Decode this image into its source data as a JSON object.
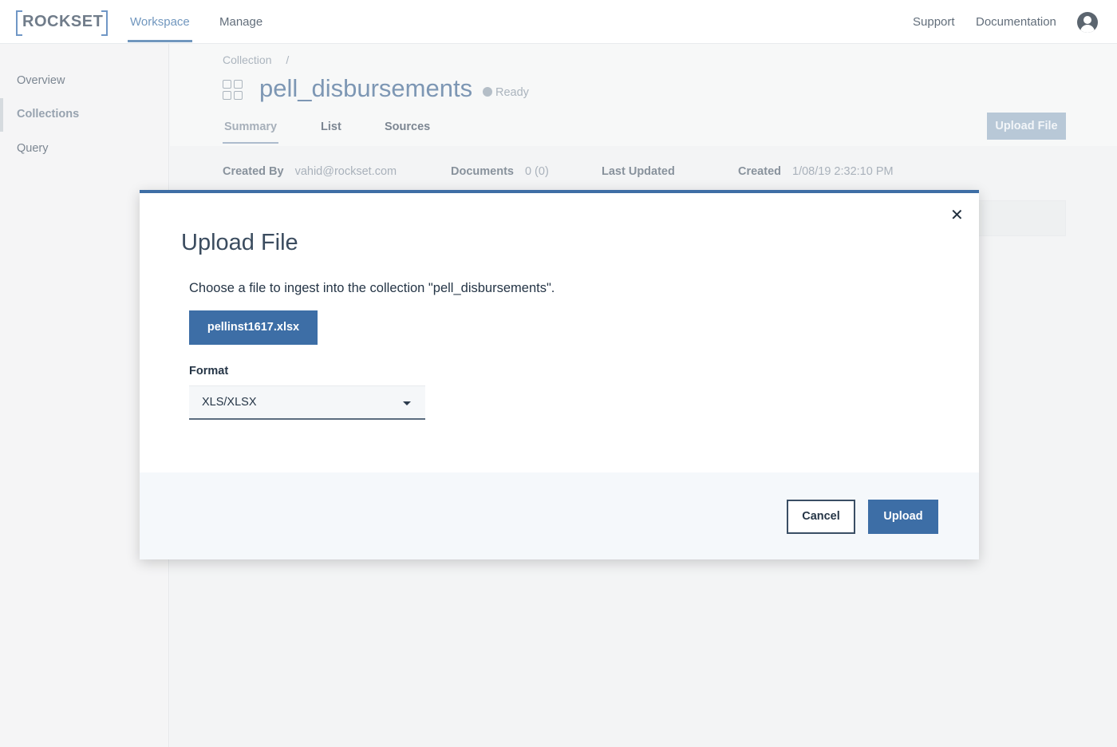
{
  "topbar": {
    "logo": "ROCKSET",
    "nav": [
      {
        "label": "Workspace",
        "active": true
      },
      {
        "label": "Manage",
        "active": false
      }
    ],
    "support_label": "Support",
    "documentation_label": "Documentation",
    "avatar_icon": "user-avatar-icon"
  },
  "sidebar": {
    "items": [
      {
        "label": "Overview",
        "active": false
      },
      {
        "label": "Collections",
        "active": true
      },
      {
        "label": "Query",
        "active": false
      }
    ]
  },
  "collection": {
    "breadcrumb": "Collection",
    "breadcrumb_sep": "/",
    "icon": "collection-grid-icon",
    "name": "pell_disbursements",
    "status": "Ready",
    "tabs": [
      {
        "label": "Summary",
        "active": true
      },
      {
        "label": "List",
        "active": false
      },
      {
        "label": "Sources",
        "active": false
      }
    ],
    "upload_button_label": "Upload File",
    "meta": {
      "created_by_label": "Created By",
      "created_by_value": "vahid@rockset.com",
      "documents_label": "Documents",
      "documents_value": "0 (0)",
      "last_updated_label": "Last Updated",
      "created_label": "Created",
      "created_value": "1/08/19 2:32:10 PM"
    }
  },
  "modal": {
    "title": "Upload File",
    "close_icon": "close-icon",
    "description": "Choose a file to ingest into the collection \"pell_disbursements\".",
    "file_button_label": "pellinst1617.xlsx",
    "format_label": "Format",
    "format_value": "XLS/XLSX",
    "cancel_label": "Cancel",
    "upload_label": "Upload",
    "accent_color": "#3d6ea6"
  }
}
